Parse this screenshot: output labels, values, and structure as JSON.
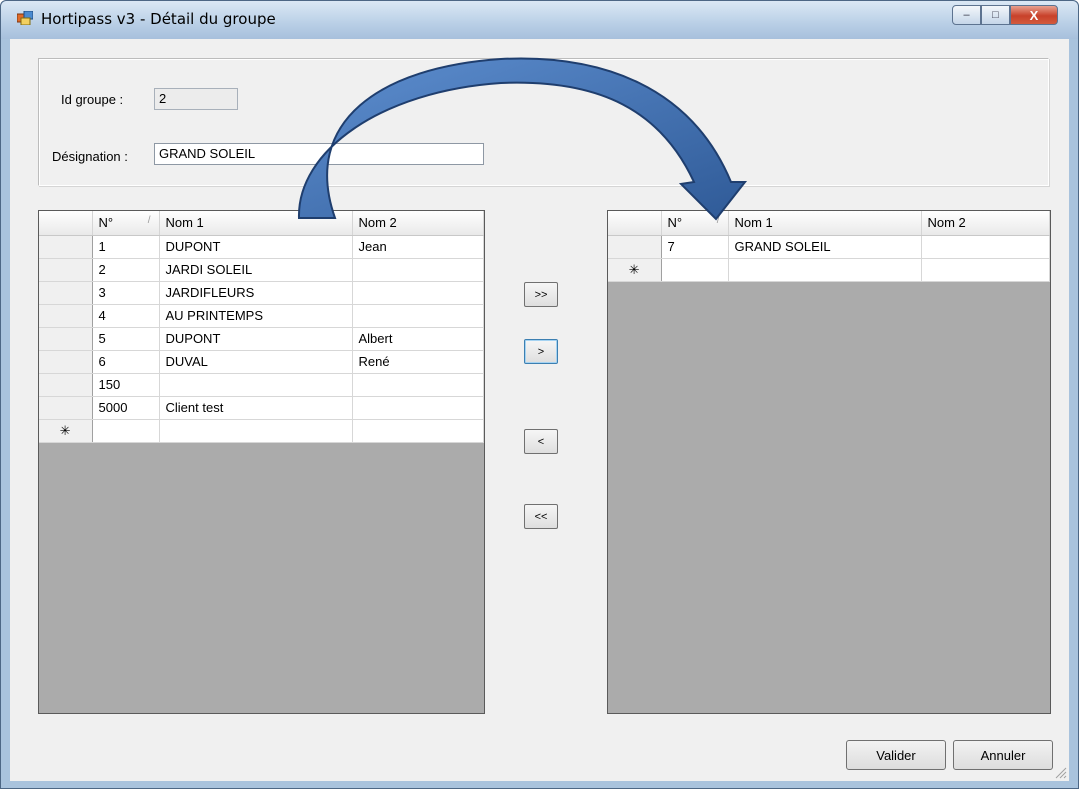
{
  "window": {
    "title": "Hortipass v3 - Détail du groupe",
    "buttons": {
      "minimize": "–",
      "maximize": "□",
      "close": "X"
    }
  },
  "form": {
    "id_label": "Id groupe :",
    "id_value": "2",
    "designation_label": "Désignation :",
    "designation_value": "GRAND SOLEIL"
  },
  "left_grid": {
    "columns": [
      "N°",
      "Nom 1",
      "Nom 2"
    ],
    "rows": [
      [
        "1",
        "DUPONT",
        "Jean"
      ],
      [
        "2",
        "JARDI SOLEIL",
        ""
      ],
      [
        "3",
        "JARDIFLEURS",
        ""
      ],
      [
        "4",
        "AU PRINTEMPS",
        ""
      ],
      [
        "5",
        "DUPONT",
        "Albert"
      ],
      [
        "6",
        "DUVAL",
        "René"
      ],
      [
        "150",
        "",
        ""
      ],
      [
        "5000",
        "Client test",
        ""
      ]
    ],
    "new_row_marker": "✳"
  },
  "right_grid": {
    "columns": [
      "N°",
      "Nom 1",
      "Nom 2"
    ],
    "rows": [
      [
        "7",
        "GRAND SOLEIL",
        ""
      ]
    ],
    "new_row_marker": "✳"
  },
  "move_buttons": {
    "add_all": ">>",
    "add_one": ">",
    "remove_one": "<",
    "remove_all": "<<"
  },
  "actions": {
    "validate": "Valider",
    "cancel": "Annuler"
  },
  "colors": {
    "titlebar": "#b9cfe6",
    "client": "#f0f0f0",
    "grid_empty": "#ababab",
    "arrow": "#3c6aa8"
  }
}
